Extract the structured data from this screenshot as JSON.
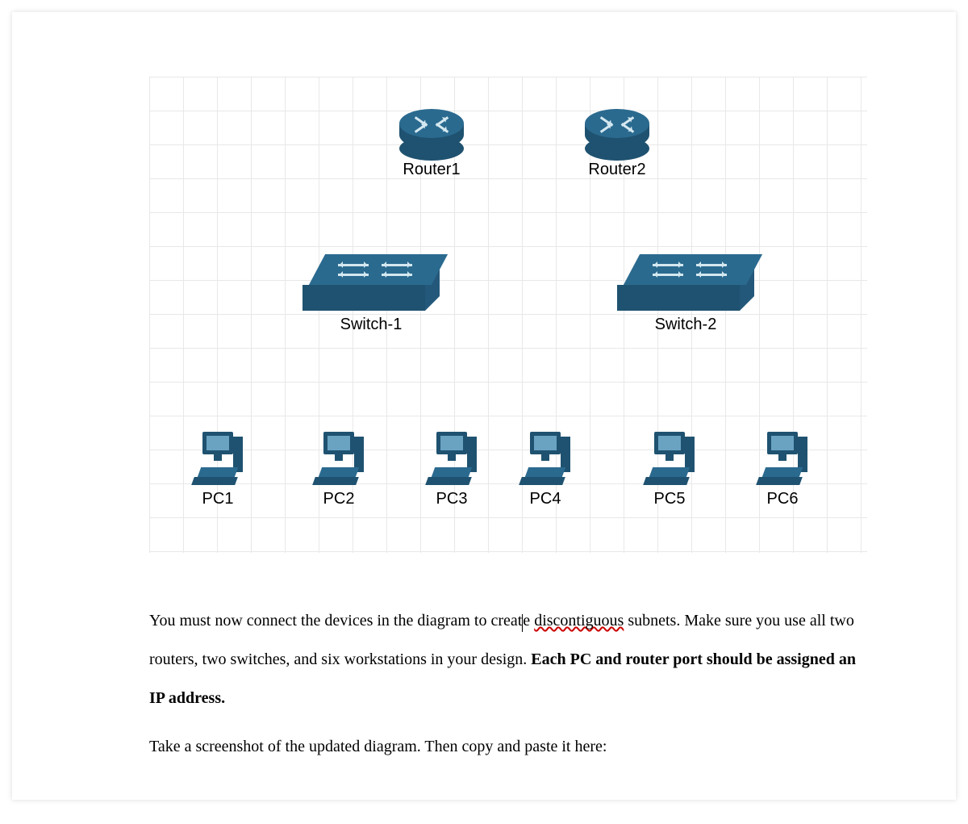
{
  "diagram": {
    "routers": [
      {
        "id": "router1",
        "label": "Router1"
      },
      {
        "id": "router2",
        "label": "Router2"
      }
    ],
    "switches": [
      {
        "id": "switch1",
        "label": "Switch-1"
      },
      {
        "id": "switch2",
        "label": "Switch-2"
      }
    ],
    "pcs": [
      {
        "id": "pc1",
        "label": "PC1"
      },
      {
        "id": "pc2",
        "label": "PC2"
      },
      {
        "id": "pc3",
        "label": "PC3"
      },
      {
        "id": "pc4",
        "label": "PC4"
      },
      {
        "id": "pc5",
        "label": "PC5"
      },
      {
        "id": "pc6",
        "label": "PC6"
      }
    ]
  },
  "text": {
    "p1a": "You must now connect the devices in the diagram to creat",
    "p1b": "e ",
    "p1_spell": "discontiguous",
    "p1c": " subnets. Make sure you use all two routers, two switches, and six workstations in your design. ",
    "p1_bold": "Each PC and router port should be assigned an IP address.",
    "p2": "Take a screenshot of the updated diagram. Then copy and paste it here:"
  }
}
